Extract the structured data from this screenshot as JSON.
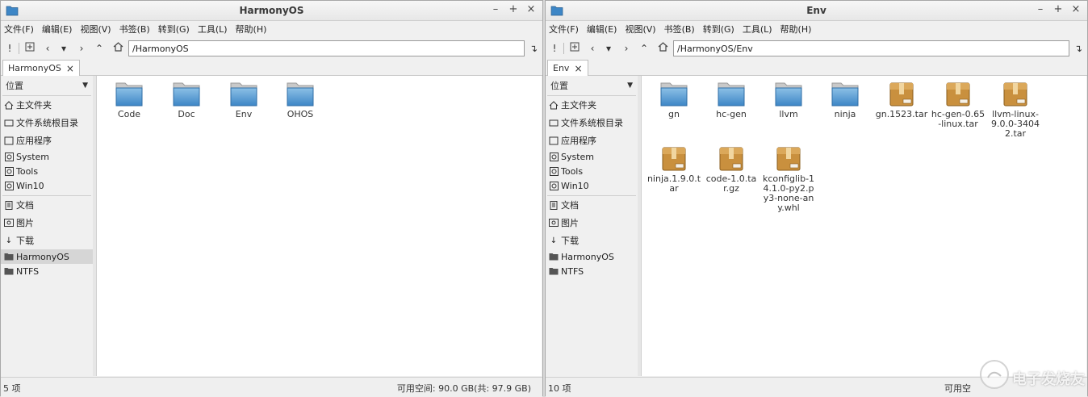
{
  "left_window": {
    "title": "HarmonyOS",
    "menu": [
      "文件(F)",
      "编辑(E)",
      "视图(V)",
      "书签(B)",
      "转到(G)",
      "工具(L)",
      "帮助(H)"
    ],
    "path": "/HarmonyOS",
    "tab_label": "HarmonyOS",
    "sidebar_header": "位置",
    "sidebar_items": [
      "主文件夹",
      "文件系统根目录",
      "应用程序",
      "System",
      "Tools",
      "Win10",
      "文档",
      "图片",
      "下载",
      "HarmonyOS",
      "NTFS"
    ],
    "files": [
      "Code",
      "Doc",
      "Env",
      "OHOS"
    ],
    "status_count": "5 项",
    "status_space": "可用空间: 90.0 GB(共: 97.9 GB)"
  },
  "right_window": {
    "title": "Env",
    "menu": [
      "文件(F)",
      "编辑(E)",
      "视图(V)",
      "书签(B)",
      "转到(G)",
      "工具(L)",
      "帮助(H)"
    ],
    "path": "/HarmonyOS/Env",
    "tab_label": "Env",
    "sidebar_header": "位置",
    "sidebar_items": [
      "主文件夹",
      "文件系统根目录",
      "应用程序",
      "System",
      "Tools",
      "Win10",
      "文档",
      "图片",
      "下载",
      "HarmonyOS",
      "NTFS"
    ],
    "files": [
      "gn",
      "hc-gen",
      "llvm",
      "ninja",
      "gn.1523.tar",
      "hc-gen-0.65-linux.tar",
      "llvm-linux-9.0.0-34042.tar",
      "ninja.1.9.0.tar",
      "code-1.0.tar.gz",
      "kconfiglib-14.1.0-py2.py3-none-any.whl"
    ],
    "status_count": "10 项",
    "status_space": "可用空"
  },
  "watermark": {
    "text": "电子发烧友"
  },
  "icons": {
    "folder": "folder-icon",
    "archive": "archive-icon",
    "home": "home-icon",
    "close": "close-icon"
  },
  "colors": {
    "folder_top": "#8cc0e6",
    "folder_bottom": "#3d86c6",
    "archive": "#c9903e",
    "selected_sidebar": "#d6d6d6"
  }
}
